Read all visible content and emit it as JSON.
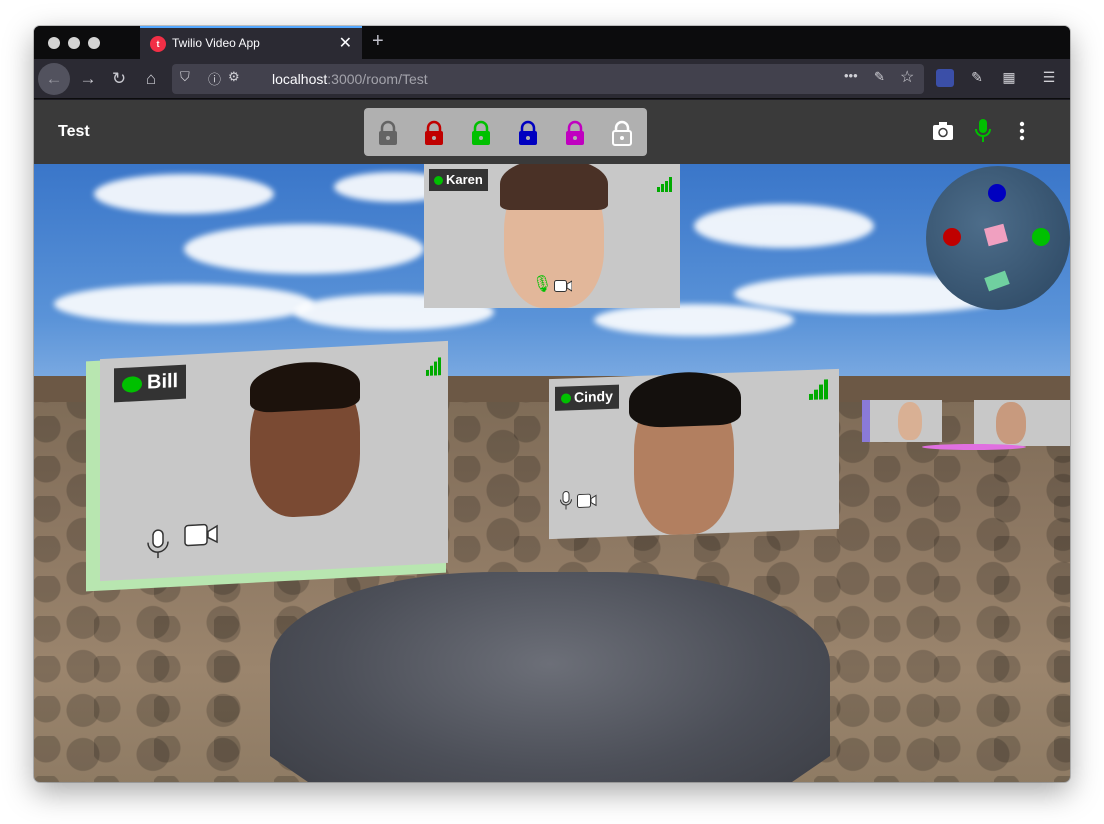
{
  "browser": {
    "tab_title": "Twilio Video App",
    "tab_favicon_letter": "t",
    "url_host": "localhost",
    "url_rest": ":3000/room/Test"
  },
  "app": {
    "room_title": "Test",
    "lock_colors": [
      "#646464",
      "#c00000",
      "#00c000",
      "#0000c0",
      "#c000c0"
    ],
    "participants": [
      {
        "name": "Karen"
      },
      {
        "name": "Bill"
      },
      {
        "name": "Cindy"
      }
    ]
  },
  "colors": {
    "accent_blue": "#54a8ff",
    "status_green": "#00c000",
    "minimap_blue": "#0000c0",
    "minimap_red": "#c00000",
    "minimap_green": "#00c000"
  }
}
